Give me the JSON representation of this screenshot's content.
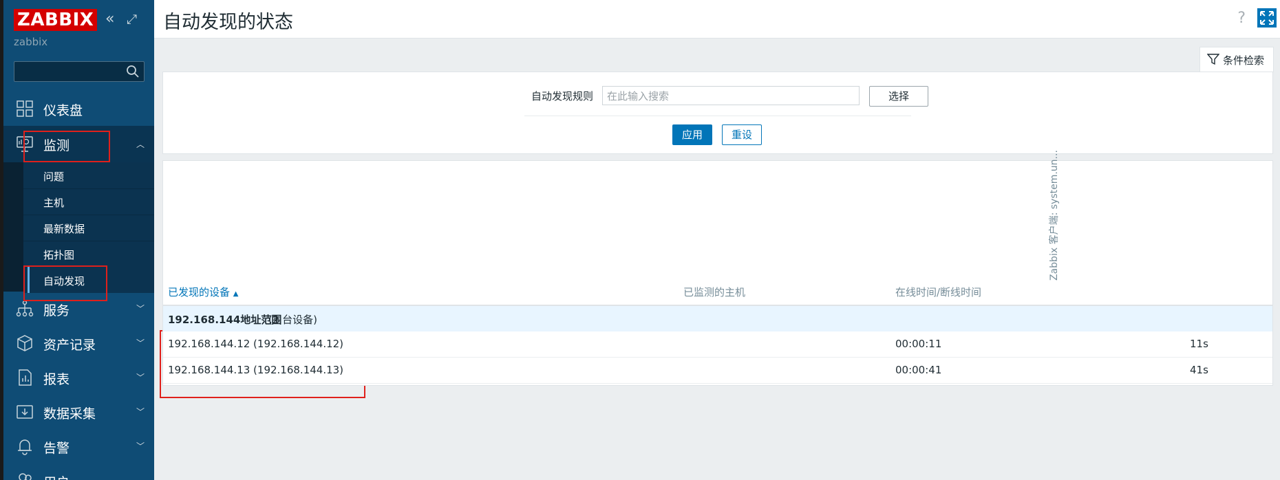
{
  "app": {
    "logo_text": "ZABBIX",
    "username": "zabbix"
  },
  "sidebar": {
    "collapse_icon": "«",
    "kiosk_icon": "⤢",
    "items": [
      {
        "label": "仪表盘",
        "icon": "dashboard-icon"
      },
      {
        "label": "监测",
        "icon": "monitoring-icon"
      },
      {
        "label": "服务",
        "icon": "services-icon"
      },
      {
        "label": "资产记录",
        "icon": "inventory-icon"
      },
      {
        "label": "报表",
        "icon": "reports-icon"
      },
      {
        "label": "数据采集",
        "icon": "data-collection-icon"
      },
      {
        "label": "告警",
        "icon": "alerts-icon"
      },
      {
        "label": "用户",
        "icon": "users-icon"
      }
    ],
    "monitoring_sub": [
      {
        "label": "问题"
      },
      {
        "label": "主机"
      },
      {
        "label": "最新数据"
      },
      {
        "label": "拓扑图"
      },
      {
        "label": "自动发现"
      }
    ]
  },
  "header": {
    "title": "自动发现的状态",
    "help": "?"
  },
  "filter": {
    "tab_label": "条件检索",
    "rule_label": "自动发现规则",
    "rule_placeholder": "在此输入搜索",
    "select_label": "选择",
    "apply_label": "应用",
    "reset_label": "重设"
  },
  "table": {
    "columns": {
      "discovered_device": "已发现的设备",
      "sort_indicator": "▲",
      "monitored_host": "已监测的主机",
      "uptime_downtime": "在线时间/断线时间",
      "check": "Zabbix 客户端: system.un..."
    },
    "group": {
      "name": "192.168.144地址范围",
      "count": "(2 台设备)"
    },
    "rows": [
      {
        "device": "192.168.144.12 (192.168.144.12)",
        "host": "",
        "uptime": "00:00:11",
        "check": "11s"
      },
      {
        "device": "192.168.144.13 (192.168.144.13)",
        "host": "",
        "uptime": "00:00:41",
        "check": "41s"
      }
    ]
  },
  "colors": {
    "sidebar_bg": "#0f4c75",
    "accent": "#0275b8",
    "highlight": "#e0201b",
    "logo_bg": "#d40000"
  }
}
